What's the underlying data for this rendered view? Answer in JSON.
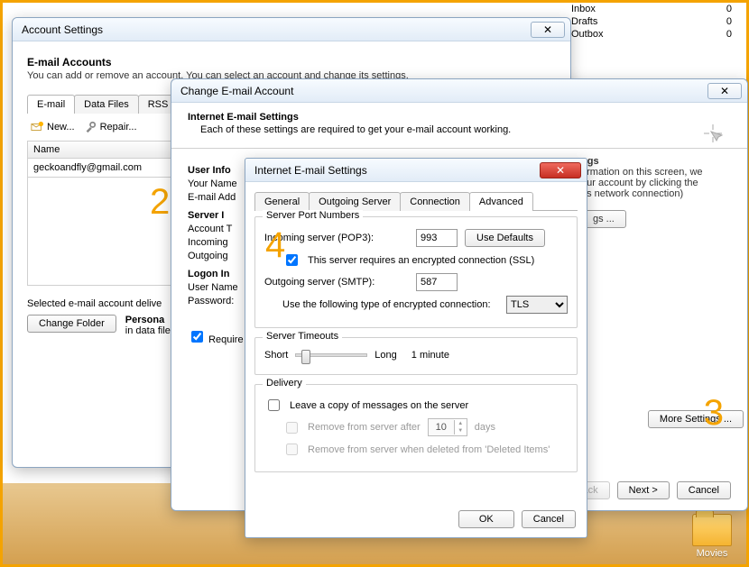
{
  "maillist": {
    "items": [
      {
        "name": "Inbox",
        "count": "0"
      },
      {
        "name": "Drafts",
        "count": "0"
      },
      {
        "name": "Outbox",
        "count": "0"
      }
    ]
  },
  "desktop": {
    "folder_label": "Movies"
  },
  "acct": {
    "title": "Account Settings",
    "heading": "E-mail Accounts",
    "sub": "You can add or remove an account. You can select an account and change its settings.",
    "tabs": {
      "email": "E-mail",
      "datafiles": "Data Files",
      "rss": "RSS Feed"
    },
    "toolbar": {
      "new": "New...",
      "repair": "Repair..."
    },
    "list_header": "Name",
    "email_row": "geckoandfly@gmail.com",
    "delivery_text": "Selected e-mail account delive",
    "change_folder_btn": "Change Folder",
    "personal": "Persona",
    "datafile": "in data file"
  },
  "chg": {
    "title": "Change E-mail Account",
    "banner_heading": "Internet E-mail Settings",
    "banner_sub": "Each of these settings are required to get your e-mail account working.",
    "sections": {
      "userinfo": "User Info",
      "serverinfo": "Server I",
      "logon": "Logon In"
    },
    "labels": {
      "yourname": "Your Name",
      "emailaddr": "E-mail Add",
      "accounttype": "Account T",
      "incoming": "Incoming",
      "outgoing": "Outgoing",
      "username": "User Name",
      "password": "Password:"
    },
    "require_chk": "Require",
    "right": {
      "l1": "ngs",
      "l2": "ormation on this screen, we",
      "l3": "our account by clicking the",
      "l4": "es network connection)",
      "settings_btn": "gs ..."
    },
    "more_settings": "More Settings ...",
    "back": "< Back",
    "next": "Next >",
    "cancel": "Cancel"
  },
  "inet": {
    "title": "Internet E-mail Settings",
    "tabs": {
      "general": "General",
      "outgoing": "Outgoing Server",
      "connection": "Connection",
      "advanced": "Advanced"
    },
    "fs_ports": "Server Port Numbers",
    "incoming_lbl": "Incoming server (POP3):",
    "incoming_val": "993",
    "use_defaults": "Use Defaults",
    "ssl_chk": "This server requires an encrypted connection (SSL)",
    "outgoing_lbl": "Outgoing server (SMTP):",
    "outgoing_val": "587",
    "enc_lbl": "Use the following type of encrypted connection:",
    "enc_val": "TLS",
    "fs_timeouts": "Server Timeouts",
    "short": "Short",
    "long": "Long",
    "timeout_val": "1 minute",
    "fs_delivery": "Delivery",
    "leave_copy": "Leave a copy of messages on the server",
    "remove_after_pre": "Remove from server after",
    "remove_after_days": "10",
    "remove_after_post": "days",
    "remove_deleted": "Remove from server when deleted from 'Deleted Items'",
    "ok": "OK",
    "cancel": "Cancel"
  },
  "annotations": {
    "n2": "2",
    "n3": "3",
    "n4": "4"
  }
}
